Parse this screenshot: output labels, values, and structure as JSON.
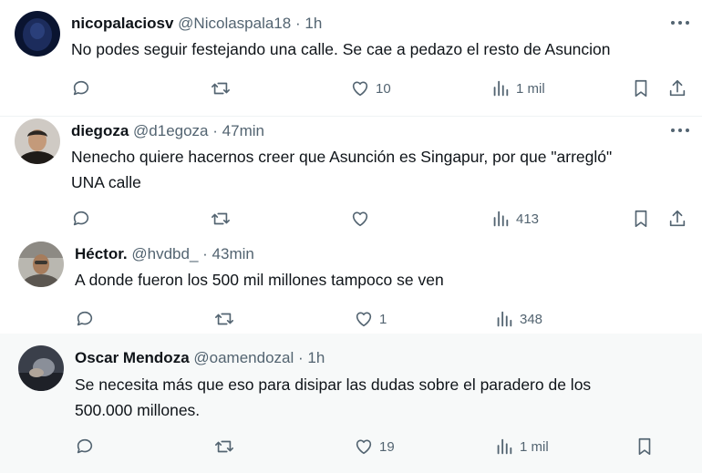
{
  "replies": [
    {
      "name": "nicopalaciosv",
      "handle": "@Nicolaspala18",
      "separator": "·",
      "time": "1h",
      "text_lines": [
        "No podes seguir festejando una calle. Se cae a pedazo el resto de Asuncion"
      ],
      "counts": {
        "replies": "",
        "reposts": "",
        "likes": "10",
        "views": "1 mil"
      },
      "avatar_colors": {
        "bg": "#0a1430",
        "fg": "#2a3f7a"
      }
    },
    {
      "name": "diegoza",
      "handle": "@d1egoza",
      "separator": "·",
      "time": "47min",
      "text_lines": [
        "Nenecho quiere hacernos creer que Asunción es Singapur, por que \"arregló\"",
        "UNA calle"
      ],
      "counts": {
        "replies": "",
        "reposts": "",
        "likes": "",
        "views": "413"
      },
      "avatar_colors": {
        "bg": "#cfcac4",
        "fg": "#2b2622"
      }
    },
    {
      "name": "Héctor.",
      "handle": "@hvdbd_",
      "separator": "·",
      "time": "43min",
      "text_lines": [
        "A donde fueron los 500 mil millones tampoco se ven"
      ],
      "counts": {
        "replies": "",
        "reposts": "",
        "likes": "1",
        "views": "348"
      },
      "avatar_colors": {
        "bg": "#b9b7b0",
        "fg": "#4a4640"
      }
    },
    {
      "name": "Oscar Mendoza",
      "handle": "@oamendozal",
      "separator": "·",
      "time": "1h",
      "text_lines": [
        "Se necesita más que eso para disipar las dudas sobre el paradero de los",
        "500.000 millones."
      ],
      "counts": {
        "replies": "",
        "reposts": "",
        "likes": "19",
        "views": "1 mil"
      },
      "avatar_colors": {
        "bg": "#3a3f4a",
        "fg": "#8a8f99"
      }
    }
  ],
  "icons": [
    "reply-icon",
    "repost-icon",
    "like-icon",
    "views-icon",
    "bookmark-icon",
    "share-icon",
    "more-icon"
  ],
  "colors": {
    "text": "#0f1419",
    "secondary": "#536471",
    "highlight_bg": "#f7f9f9",
    "divider": "#eff3f4"
  }
}
